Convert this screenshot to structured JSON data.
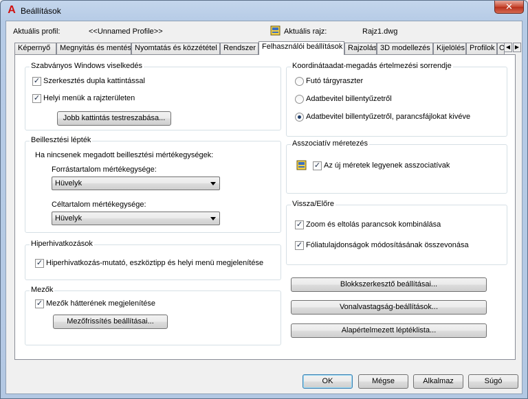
{
  "window": {
    "title": "Beállítások",
    "close_glyph": "✕"
  },
  "profile": {
    "current_profile_label": "Aktuális profil:",
    "current_profile_value": "<<Unnamed Profile>>",
    "current_drawing_label": "Aktuális rajz:",
    "current_drawing_value": "Rajz1.dwg"
  },
  "tabs": [
    {
      "label": "Képernyő"
    },
    {
      "label": "Megnyitás és mentés"
    },
    {
      "label": "Nyomtatás és közzététel"
    },
    {
      "label": "Rendszer"
    },
    {
      "label": "Felhasználói beállítások"
    },
    {
      "label": "Rajzolás"
    },
    {
      "label": "3D modellezés"
    },
    {
      "label": "Kijelölés"
    },
    {
      "label": "Profilok"
    },
    {
      "label": "O"
    }
  ],
  "tab_scroll": {
    "left": "◀",
    "right": "▶"
  },
  "windows_behavior": {
    "title": "Szabványos Windows viselkedés",
    "double_click_edit": "Szerkesztés dupla kattintással",
    "shortcut_menus": "Helyi menük a rajzterületen",
    "right_click_button": "Jobb kattintás testreszabása..."
  },
  "insertion_scale": {
    "title": "Beillesztési lépték",
    "hint": "Ha nincsenek megadott beillesztési mértékegységek:",
    "source_label": "Forrástartalom mértékegysége:",
    "source_value": "Hüvelyk",
    "target_label": "Céltartalom mértékegysége:",
    "target_value": "Hüvelyk"
  },
  "hyperlink": {
    "title": "Hiperhivatkozások",
    "display": "Hiperhivatkozás-mutató, eszköztipp és helyi menü megjelenítése"
  },
  "fields": {
    "title": "Mezők",
    "background": "Mezők hátterének megjelenítése",
    "update_button": "Mezőfrissítés beállításai..."
  },
  "coordinate_priority": {
    "title": "Koordinátaadat-megadás értelmezési sorrendje",
    "opt_running_snap": "Futó tárgyraszter",
    "opt_keyboard": "Adatbevitel billentyűzetről",
    "opt_keyboard_except": "Adatbevitel billentyűzetről, parancsfájlokat kivéve"
  },
  "assoc_dim": {
    "title": "Asszociatív méretezés",
    "new_assoc": "Az új méretek legyenek asszociatívak"
  },
  "undo_redo": {
    "title": "Vissza/Előre",
    "combine_zoom_pan": "Zoom és eltolás parancsok kombinálása",
    "combine_layer": "Fóliatulajdonságok módosításának összevonása"
  },
  "right_buttons": {
    "block_editor": "Blokkszerkesztő beállításai...",
    "lineweight": "Vonalvastagság-beállítások...",
    "default_scale": "Alapértelmezett léptéklista..."
  },
  "footer": {
    "ok": "OK",
    "cancel": "Mégse",
    "apply": "Alkalmaz",
    "help": "Súgó"
  },
  "check_glyph": "✓",
  "colors": {
    "accent": "#3c7fb1",
    "title_bar": "#c4d6ec",
    "close_red": "#c7462f"
  }
}
